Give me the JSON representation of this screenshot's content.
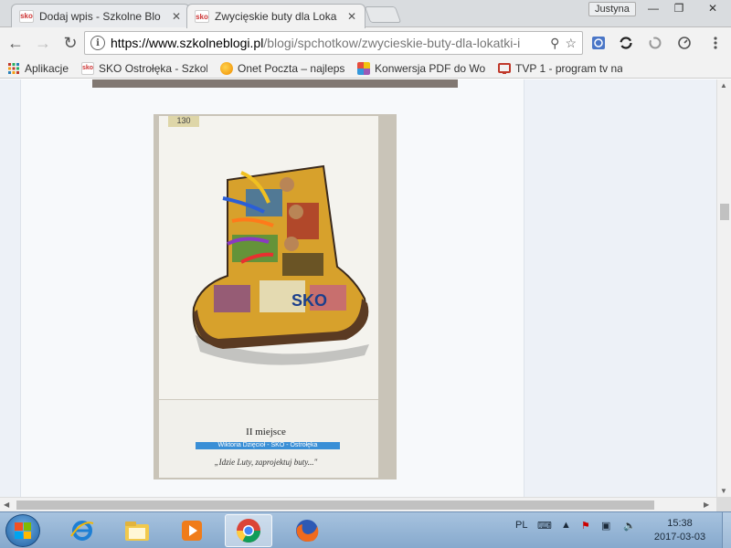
{
  "tabs": [
    {
      "favicon": "sko",
      "title": "Dodaj wpis - Szkolne Blo",
      "active": false
    },
    {
      "favicon": "sko",
      "title": "Zwycięskie buty dla Loka",
      "active": true
    }
  ],
  "window": {
    "profile": "Justyna",
    "minimize": "—",
    "maximize": "❐",
    "close": "✕"
  },
  "toolbar": {
    "back": "←",
    "forward": "→",
    "reload": "↻",
    "url_domain": "https://www.szkolneblogi.pl",
    "url_path": "/blogi/spchotkow/zwycieskie-buty-dla-lokatki-i",
    "zoom_icon": "⚲",
    "star_icon": "☆"
  },
  "bookmarks": [
    {
      "label": "Aplikacje",
      "icon": "apps-grid",
      "color": "#c0392b"
    },
    {
      "label": "SKO Ostrołęka - Szkol",
      "icon": "sko",
      "color": "#e74c3c"
    },
    {
      "label": "Onet Poczta – najleps",
      "icon": "onet",
      "color": "#f39c12"
    },
    {
      "label": "Konwersja PDF do Wo",
      "icon": "pdf-convert",
      "color": "#9b59b6"
    },
    {
      "label": "TVP 1 - program tv na",
      "icon": "tvp",
      "color": "#c0392b"
    }
  ],
  "content": {
    "photo_tag": "130",
    "caption_place": "II miejsce",
    "caption_band": "Wiktoria Dzięcioł - SKO - Ostrołęka",
    "caption_quote": "„Idzie Luty, zaprojektuj buty...\""
  },
  "taskbar": {
    "apps": [
      "windows-start",
      "internet-explorer",
      "file-explorer",
      "media-player",
      "chrome",
      "firefox"
    ],
    "lang": "PL",
    "time": "15:38",
    "date": "2017-03-03"
  },
  "colors": {
    "accent": "#3a8fd6",
    "page_bg": "#edf1f7"
  }
}
